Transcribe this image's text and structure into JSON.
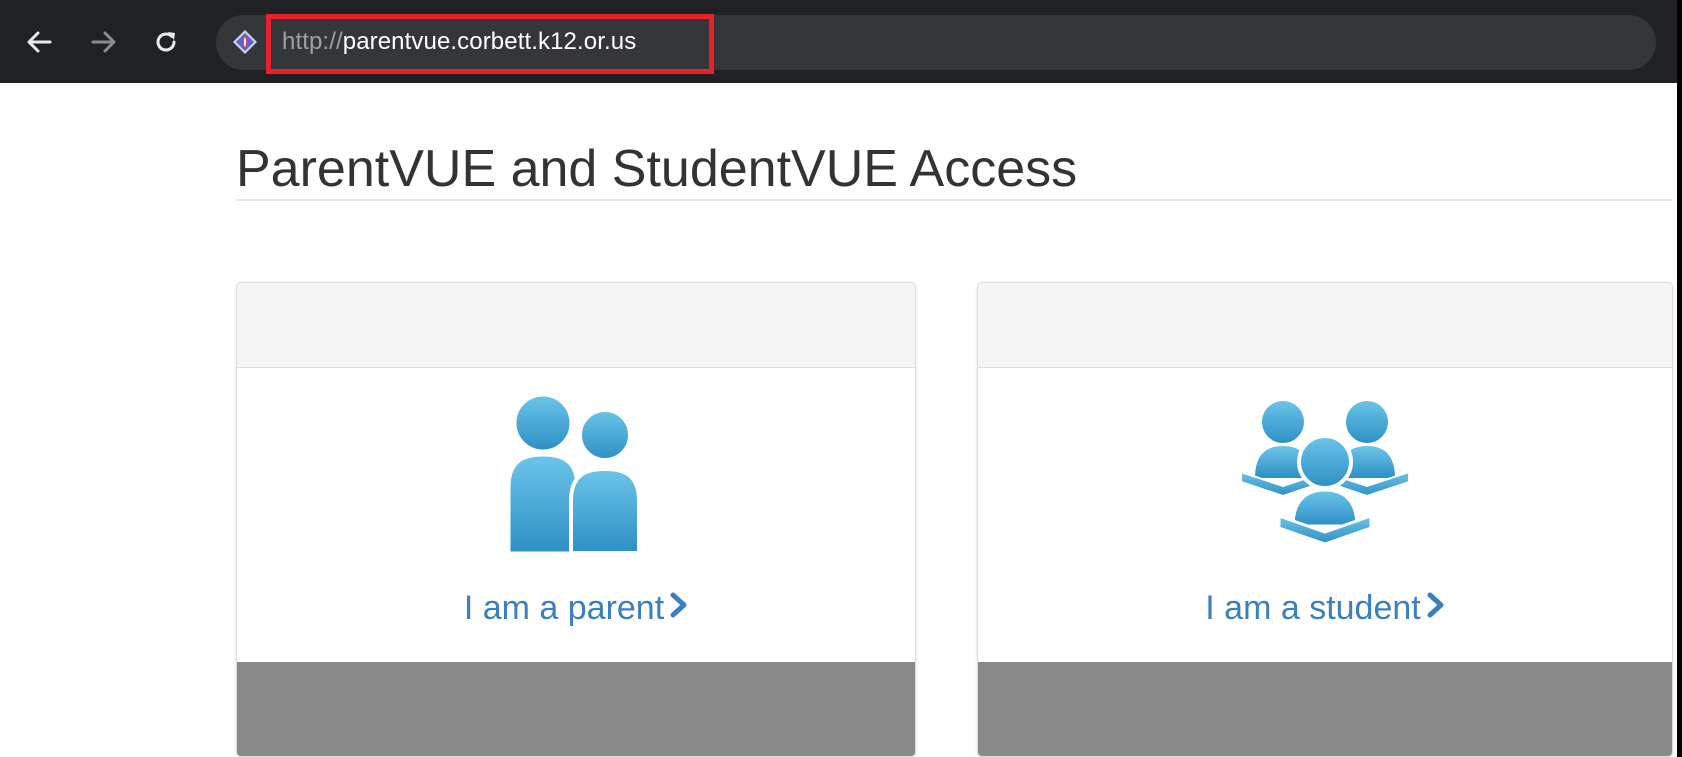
{
  "browser": {
    "url_scheme": "http://",
    "url_host": "parentvue.corbett.k12.or.us",
    "nav_icons": [
      "back-arrow-icon",
      "forward-arrow-icon",
      "reload-icon",
      "site-favicon-icon"
    ],
    "highlight_color": "#e8212b"
  },
  "page": {
    "title": "ParentVUE and StudentVUE Access"
  },
  "cards": {
    "parent": {
      "link_label": "I am a parent",
      "icon": "parents-icon"
    },
    "student": {
      "link_label": "I am a student",
      "icon": "students-reading-icon"
    }
  },
  "colors": {
    "link": "#3b7fc0",
    "icon_blue": "#5bb8e0",
    "footer_gray": "#898989",
    "header_gray": "#f5f5f5"
  }
}
